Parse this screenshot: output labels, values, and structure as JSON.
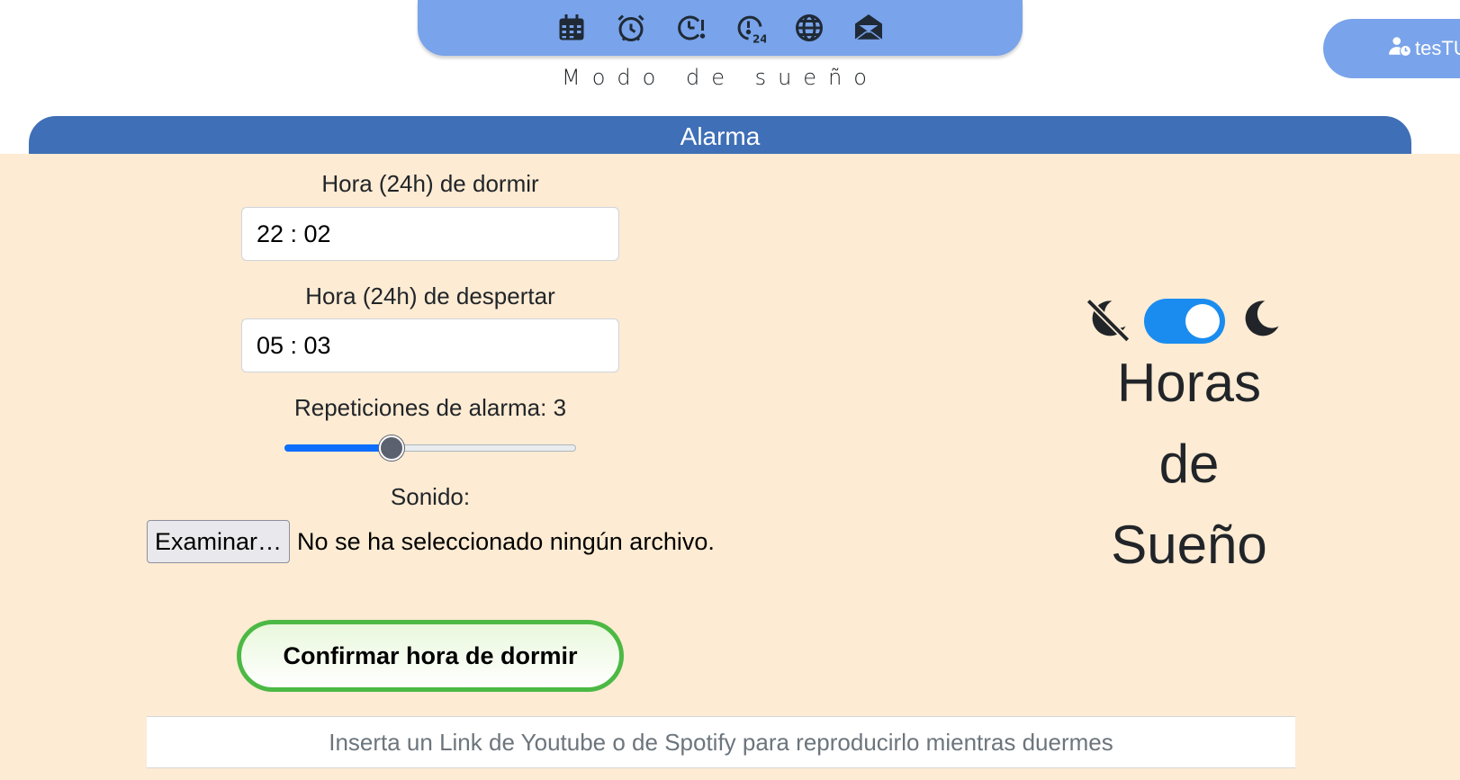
{
  "nav": {
    "icons": [
      "calendar-icon",
      "alarm-clock-icon",
      "clock-alert-icon",
      "clock-24-icon",
      "globe-icon",
      "envelope-open-icon"
    ]
  },
  "user": {
    "name": "tesTU",
    "icon": "user-clock-icon"
  },
  "mode_title": "Modo de sueño",
  "section": {
    "title": "Alarma"
  },
  "form": {
    "sleep_label": "Hora (24h) de dormir",
    "sleep_time": "22 : 02",
    "wake_label": "Hora (24h) de despertar",
    "wake_time": "05 : 03",
    "repetitions_label": "Repeticiones de alarma: 3",
    "repetitions_value": 3,
    "repetitions_min": 1,
    "repetitions_max": 10,
    "sound_label": "Sonido:",
    "file_button": "Examinar…",
    "file_status": "No se ha seleccionado ningún archivo.",
    "confirm_button": "Confirmar hora de dormir",
    "link_placeholder": "Inserta un Link de Youtube o de Spotify para reproducirlo mientras duermes"
  },
  "sleep_panel": {
    "toggle_on": true,
    "title_line1": "Horas",
    "title_line2": "de",
    "title_line3": "Sueño",
    "icon_off": "moon-slash-icon",
    "icon_on": "moon-icon"
  },
  "colors": {
    "nav_bg": "#79a3ea",
    "header_bg": "#3f6fb6",
    "panel_bg": "#fdebd3",
    "confirm_border": "#4cb944",
    "toggle_on": "#1a8cf0"
  }
}
